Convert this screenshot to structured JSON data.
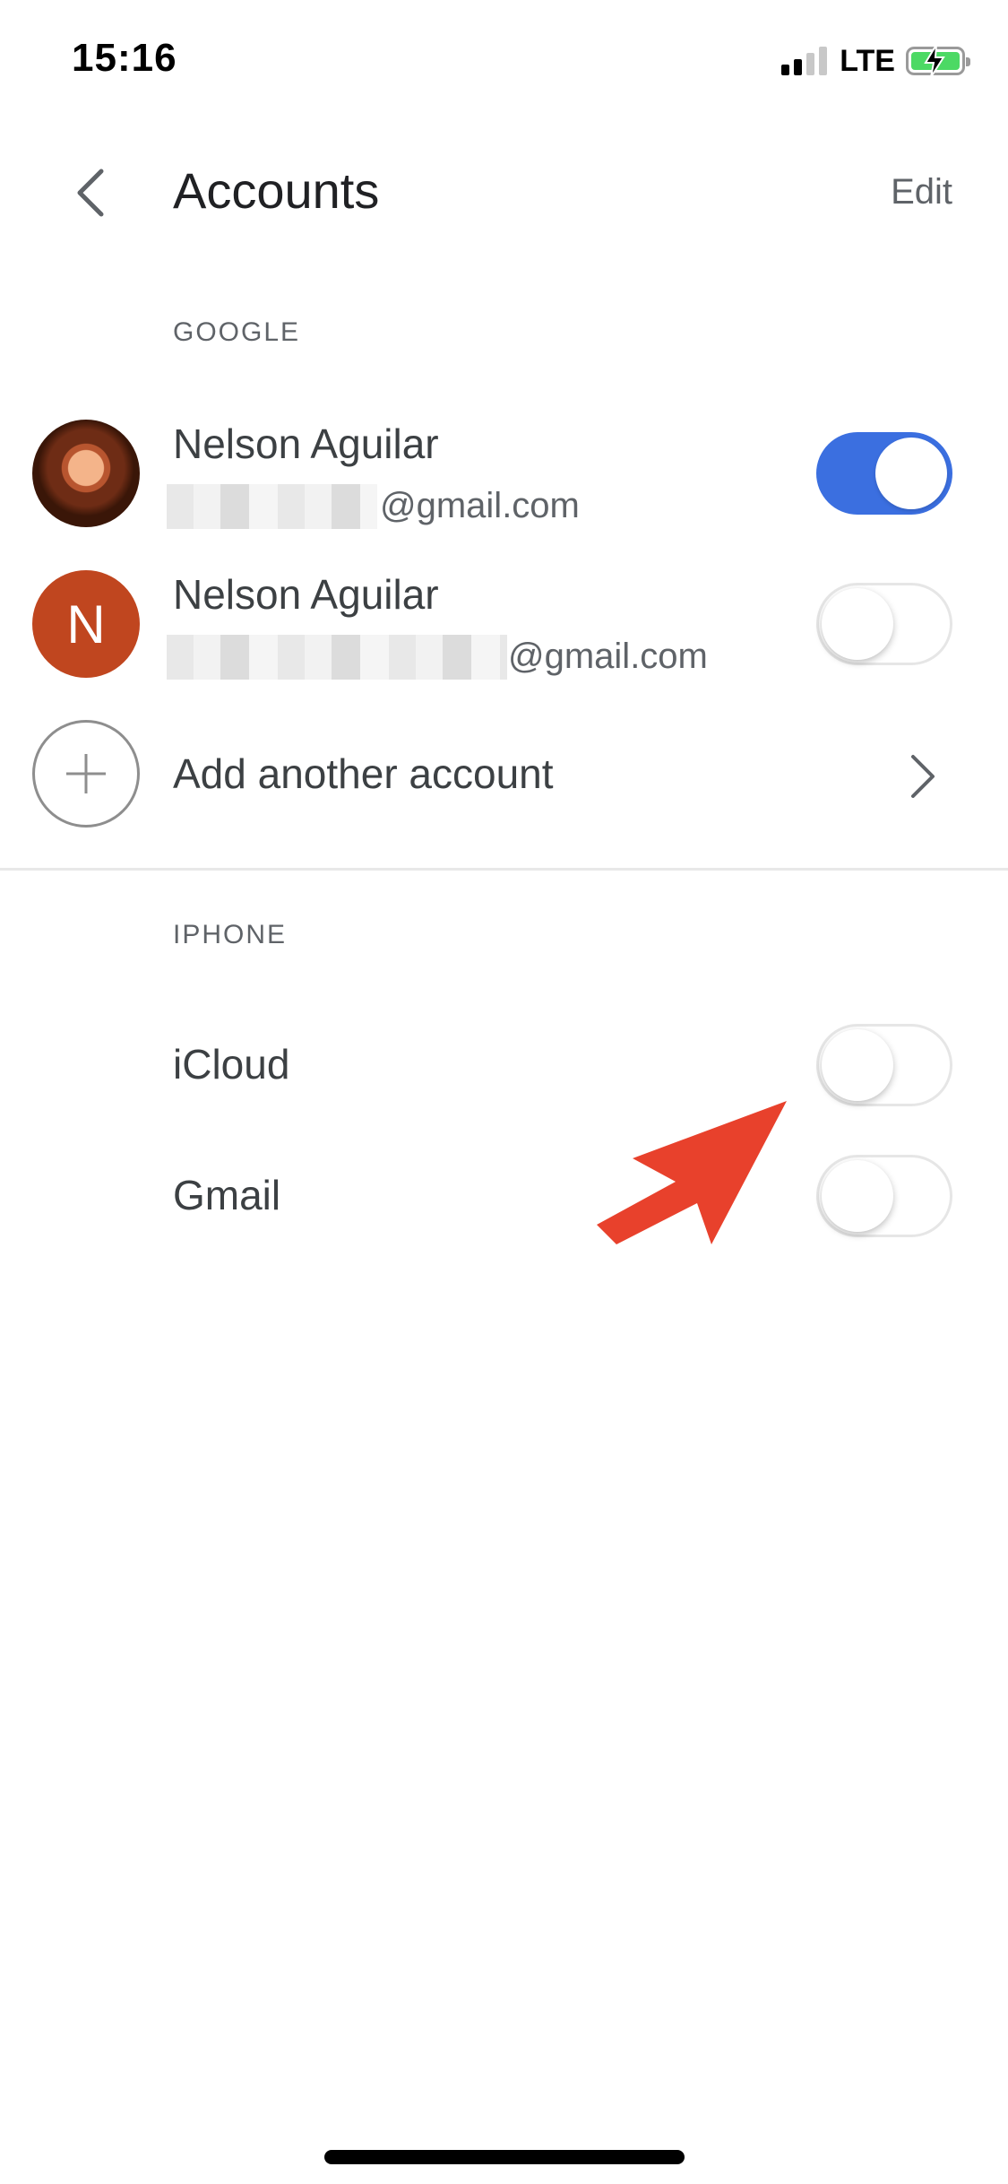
{
  "status_bar": {
    "time": "15:16",
    "network": "LTE",
    "signal_bars": 2,
    "battery_charging": true,
    "battery_color": "#4cd964"
  },
  "header": {
    "back_icon": "chevron-left-icon",
    "title": "Accounts",
    "edit_label": "Edit"
  },
  "google_section": {
    "header": "GOOGLE",
    "accounts": [
      {
        "name": "Nelson Aguilar",
        "email_visible": "@gmail.com",
        "avatar": "photo",
        "enabled": true
      },
      {
        "name": "Nelson Aguilar",
        "email_visible": "@gmail.com",
        "avatar_letter": "N",
        "avatar_color": "#c0461f",
        "enabled": false
      }
    ],
    "add_account_label": "Add another account",
    "add_icon": "plus-icon",
    "chevron_icon": "chevron-right-icon"
  },
  "iphone_section": {
    "header": "IPHONE",
    "items": [
      {
        "label": "iCloud",
        "enabled": false
      },
      {
        "label": "Gmail",
        "enabled": false
      }
    ]
  },
  "colors": {
    "toggle_on": "#3b6fe0",
    "annotation_arrow": "#e8412c"
  }
}
